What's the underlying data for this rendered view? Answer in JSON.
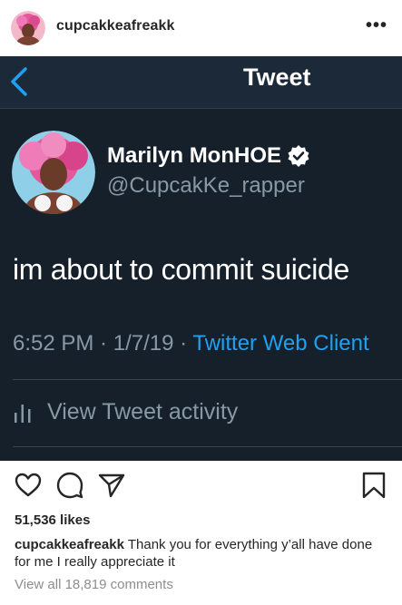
{
  "post": {
    "username": "cupcakkeafreakk",
    "more_icon": "more-horizontal-icon",
    "likes": "51,536 likes",
    "caption_user": "cupcakkeafreakk",
    "caption_text": "Thank you for everything y’all have done for me I really appreciate it",
    "view_comments": "View all 18,819 comments"
  },
  "tweet": {
    "header_title": "Tweet",
    "display_name": "Marilyn MonHOE",
    "handle": "@CupcakKe_rapper",
    "text": "im about to commit suicide",
    "time": "6:52 PM",
    "date": "1/7/19",
    "separator": " · ",
    "client": "Twitter Web Client",
    "activity_label": "View Tweet activity"
  },
  "colors": {
    "tweet_bg": "#15202b",
    "tweet_link": "#1da1f2",
    "tweet_secondary": "#8899a6"
  }
}
